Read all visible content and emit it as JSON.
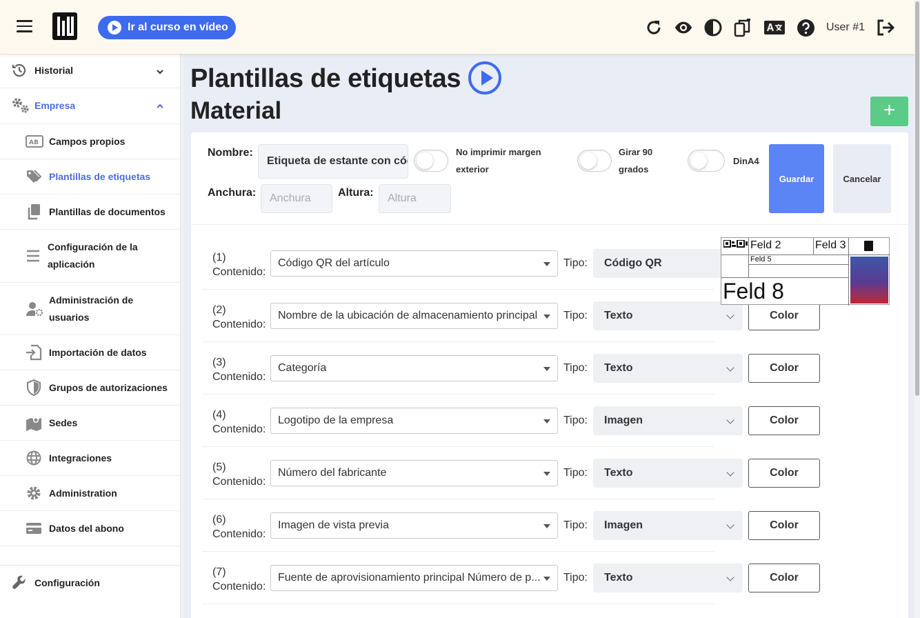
{
  "topbar": {
    "video_button": "Ir al curso en vídeo",
    "user_label": "User #1"
  },
  "sidebar": {
    "items": [
      {
        "label": "Historial"
      },
      {
        "label": "Empresa"
      },
      {
        "label": "Campos propios"
      },
      {
        "label": "Plantillas de etiquetas"
      },
      {
        "label": "Plantillas de documentos"
      },
      {
        "label": "Configuración de la aplicación"
      },
      {
        "label": "Administración de usuarios"
      },
      {
        "label": "Importación de datos"
      },
      {
        "label": "Grupos de autorizaciones"
      },
      {
        "label": "Sedes"
      },
      {
        "label": "Integraciones"
      },
      {
        "label": "Administration"
      },
      {
        "label": "Datos del abono"
      },
      {
        "label": "Configuración"
      }
    ]
  },
  "main": {
    "title": "Plantillas de etiquetas",
    "subtitle": "Material",
    "add_button": "+"
  },
  "form": {
    "name_label": "Nombre:",
    "name_value": "Etiqueta de estante con código QR",
    "width_label": "Anchura:",
    "width_placeholder": "Anchura",
    "height_label": "Altura:",
    "height_placeholder": "Altura",
    "toggle_margin_label": "No imprimir margen exterior",
    "toggle_rotate_label": "Girar 90 grados",
    "toggle_dina4_label": "DinA4",
    "save_button": "Guardar",
    "cancel_button": "Cancelar"
  },
  "rows": [
    {
      "num": "(1)",
      "content_label": "Contenido:",
      "content": "Código QR del artículo",
      "tipo_label": "Tipo:",
      "tipo": "Código QR",
      "color_button": ""
    },
    {
      "num": "(2)",
      "content_label": "Contenido:",
      "content": "Nombre de la ubicación de almacenamiento principal",
      "tipo_label": "Tipo:",
      "tipo": "Texto",
      "color_button": "Color"
    },
    {
      "num": "(3)",
      "content_label": "Contenido:",
      "content": "Categoría",
      "tipo_label": "Tipo:",
      "tipo": "Texto",
      "color_button": "Color"
    },
    {
      "num": "(4)",
      "content_label": "Contenido:",
      "content": "Logotipo de la empresa",
      "tipo_label": "Tipo:",
      "tipo": "Imagen",
      "color_button": "Color"
    },
    {
      "num": "(5)",
      "content_label": "Contenido:",
      "content": "Número del fabricante",
      "tipo_label": "Tipo:",
      "tipo": "Texto",
      "color_button": "Color"
    },
    {
      "num": "(6)",
      "content_label": "Contenido:",
      "content": "Imagen de vista previa",
      "tipo_label": "Tipo:",
      "tipo": "Imagen",
      "color_button": "Color"
    },
    {
      "num": "(7)",
      "content_label": "Contenido:",
      "content": "Fuente de aprovisionamiento principal Número de p...",
      "tipo_label": "Tipo:",
      "tipo": "Texto",
      "color_button": "Color"
    }
  ],
  "preview": {
    "feld2": "Feld 2",
    "feld3": "Feld 3",
    "feld5": "Feld 5",
    "feld8": "Feld 8"
  },
  "colors": {
    "accent": "#3d6bef",
    "save": "#5b84f4",
    "add": "#5ccb87",
    "topbar_bg": "#fdf9ee"
  }
}
